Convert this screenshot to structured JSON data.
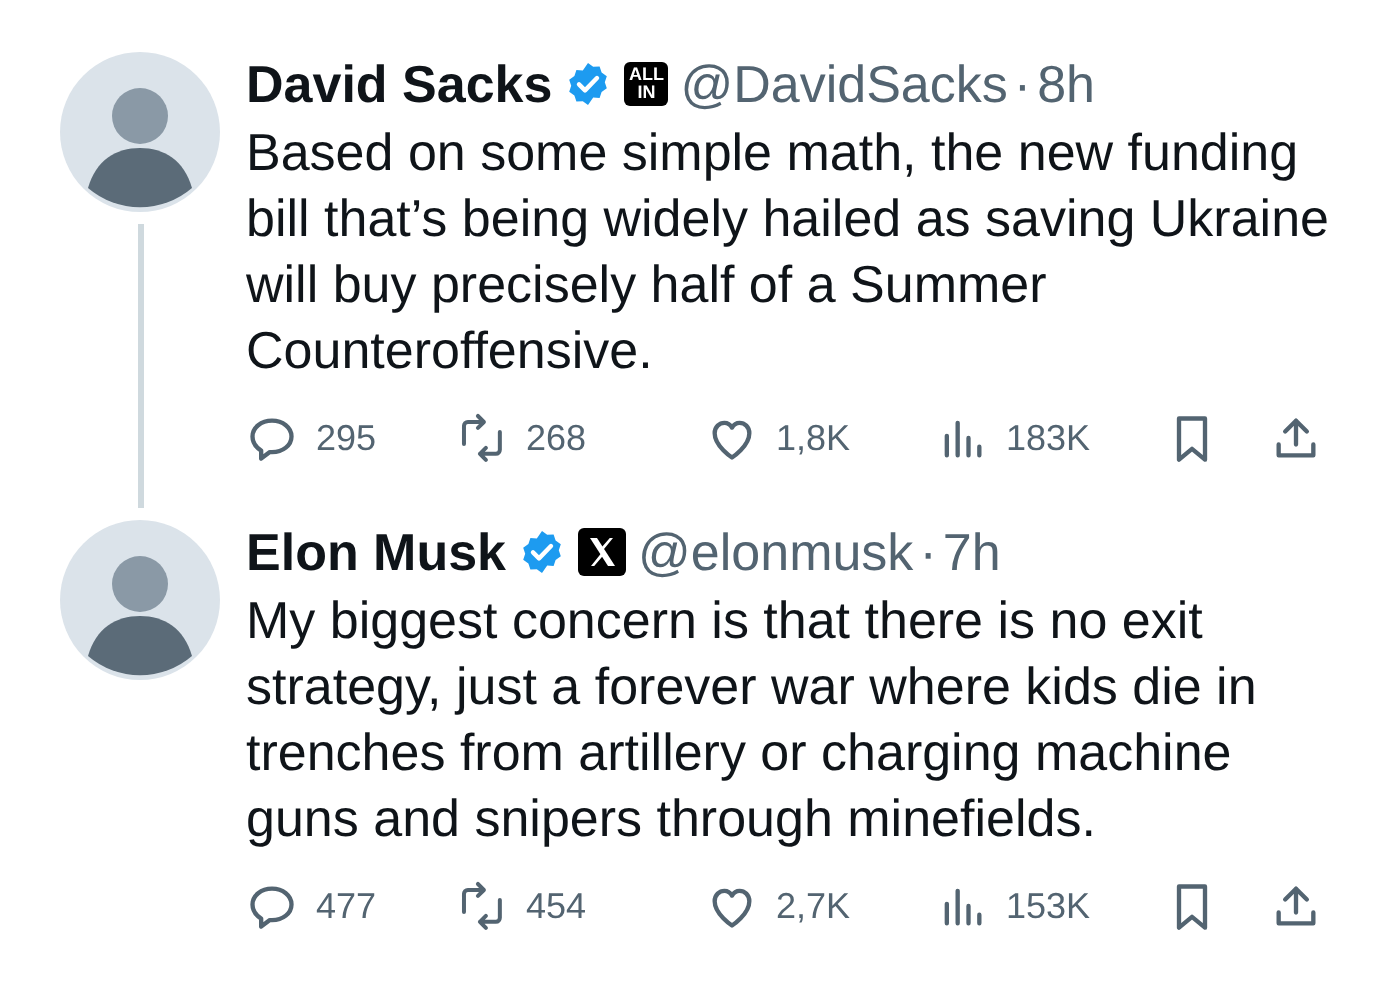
{
  "tweets": [
    {
      "name": "David Sacks",
      "verified": true,
      "affiliate": {
        "kind": "text",
        "label": "ALL IN"
      },
      "handle": "@DavidSacks",
      "separator": "·",
      "time": "8h",
      "text": "Based on some simple math, the new funding bill that’s being widely hailed as saving Ukraine will buy precisely half of a Summer Counteroffensive.",
      "thread_continues": true,
      "replies": "295",
      "reposts": "268",
      "likes": "1,8K",
      "views": "183K"
    },
    {
      "name": "Elon Musk",
      "verified": true,
      "affiliate": {
        "kind": "x-logo"
      },
      "handle": "@elonmusk",
      "separator": "·",
      "time": "7h",
      "text": "My biggest concern is that there is no exit strategy, just a forever war where kids die in trenches from artillery or charging machine guns and snipers through minefields.",
      "thread_continues": false,
      "replies": "477",
      "reposts": "454",
      "likes": "2,7K",
      "views": "153K"
    }
  ]
}
